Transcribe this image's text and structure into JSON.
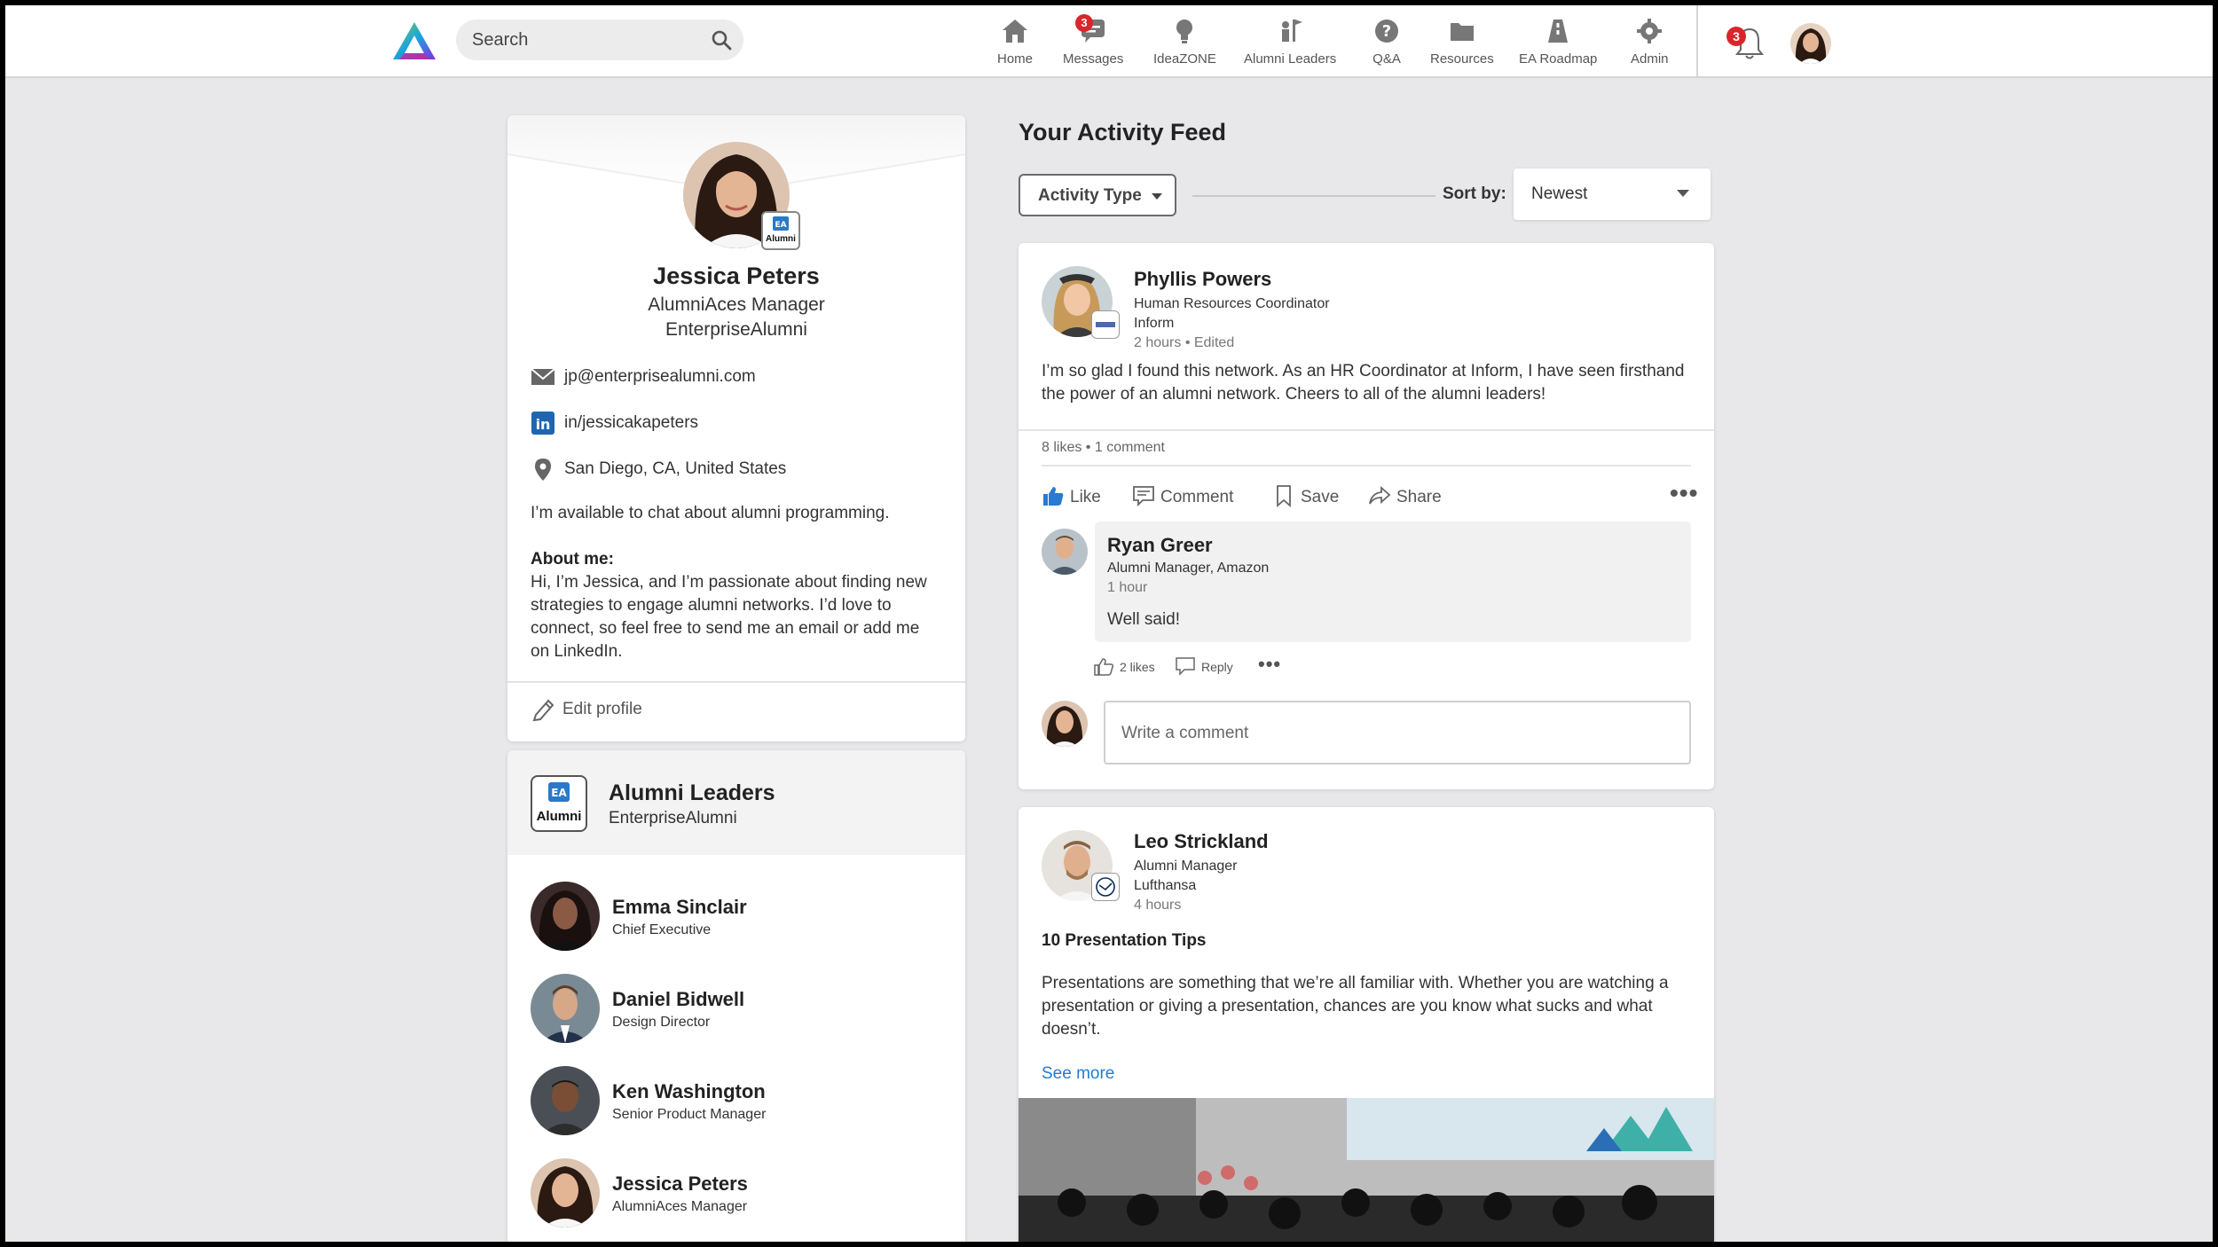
{
  "app": {
    "logo": "enterprise-alumni-logo"
  },
  "search": {
    "placeholder": "Search",
    "icon": "search-icon"
  },
  "nav": {
    "items": [
      {
        "label": "Home",
        "icon": "home-icon"
      },
      {
        "label": "Messages",
        "icon": "messages-icon",
        "badge": "3"
      },
      {
        "label": "IdeaZONE",
        "icon": "lightbulb-icon"
      },
      {
        "label": "Alumni Leaders",
        "icon": "leaders-icon"
      },
      {
        "label": "Q&A",
        "icon": "question-icon"
      },
      {
        "label": "Resources",
        "icon": "folder-icon"
      },
      {
        "label": "EA Roadmap",
        "icon": "roadmap-icon"
      },
      {
        "label": "Admin",
        "icon": "gear-icon"
      }
    ],
    "notifications_badge": "3"
  },
  "profile": {
    "name": "Jessica Peters",
    "title": "AlumniAces Manager",
    "company": "EnterpriseAlumni",
    "badge_text": "Alumni",
    "email": "jp@enterprisealumni.com",
    "linkedin": "in/jessicakapeters",
    "location": "San Diego, CA, United States",
    "availability": "I’m available to chat about alumni programming.",
    "about_heading": "About me:",
    "about_body": "Hi, I’m Jessica, and I’m passionate about finding new strategies to engage alumni networks. I’d love to connect, so feel free to send me an email or add me on LinkedIn.",
    "edit_label": "Edit profile"
  },
  "leaders": {
    "title": "Alumni Leaders",
    "subtitle": "EnterpriseAlumni",
    "logo_text": "Alumni",
    "items": [
      {
        "name": "Emma Sinclair",
        "role": "Chief Executive"
      },
      {
        "name": "Daniel Bidwell",
        "role": "Design Director"
      },
      {
        "name": "Ken Washington",
        "role": "Senior Product Manager"
      },
      {
        "name": "Jessica Peters",
        "role": "AlumniAces Manager"
      }
    ]
  },
  "feed": {
    "title": "Your Activity Feed",
    "activity_type_label": "Activity Type",
    "sort_label": "Sort by:",
    "sort_value": "Newest"
  },
  "post1": {
    "author": "Phyllis Powers",
    "role": "Human Resources Coordinator",
    "company": "Inform",
    "meta": "2 hours • Edited",
    "body": "I’m so glad I found this network. As an HR Coordinator at Inform, I have seen firsthand the power of an alumni network. Cheers to all of the alumni leaders!",
    "stats": "8 likes • 1 comment",
    "actions": {
      "like": "Like",
      "comment": "Comment",
      "save": "Save",
      "share": "Share"
    },
    "comment": {
      "author": "Ryan Greer",
      "role": "Alumni Manager, Amazon",
      "time": "1 hour",
      "text": "Well said!",
      "likes": "2 likes",
      "reply": "Reply"
    },
    "write_placeholder": "Write a comment"
  },
  "post2": {
    "author": "Leo Strickland",
    "role": "Alumni Manager",
    "company": "Lufthansa",
    "meta": "4 hours",
    "title": "10 Presentation Tips",
    "body": "Presentations are something that we’re all familiar with. Whether you are watching a presentation or giving a presentation, chances are you know what sucks and what doesn’t.",
    "see_more": "See more"
  },
  "colors": {
    "accent_blue": "#1f7bd6",
    "badge_red": "#d9262a",
    "page_bg": "#e8e8ea",
    "linkedin": "#1d67b2"
  }
}
